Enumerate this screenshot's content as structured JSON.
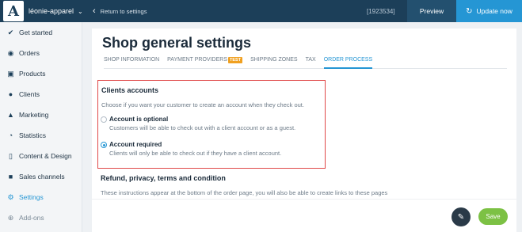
{
  "topbar": {
    "logo_letter": "A",
    "store_name": "léonie-apparel",
    "back_label": "Return to settings",
    "order_id": "[1923534]",
    "preview_label": "Preview",
    "update_label": "Update now"
  },
  "sidebar": {
    "items": [
      {
        "label": "Get started",
        "icon": "check-circle-icon"
      },
      {
        "label": "Orders",
        "icon": "dollar-circle-icon"
      },
      {
        "label": "Products",
        "icon": "cart-icon"
      },
      {
        "label": "Clients",
        "icon": "users-icon"
      },
      {
        "label": "Marketing",
        "icon": "bell-icon"
      },
      {
        "label": "Statistics",
        "icon": "pie-chart-icon"
      },
      {
        "label": "Content & Design",
        "icon": "tablet-icon"
      },
      {
        "label": "Sales channels",
        "icon": "store-icon"
      },
      {
        "label": "Settings",
        "icon": "gear-icon"
      },
      {
        "label": "Add-ons",
        "icon": "plus-circle-icon"
      }
    ]
  },
  "main": {
    "title": "Shop general settings",
    "tabs": [
      {
        "label": "SHOP INFORMATION"
      },
      {
        "label": "PAYMENT PROVIDERS",
        "badge": "TEST"
      },
      {
        "label": "SHIPPING ZONES"
      },
      {
        "label": "TAX"
      },
      {
        "label": "ORDER PROCESS"
      }
    ],
    "clients_accounts": {
      "title": "Clients accounts",
      "description": "Choose if you want your customer to create an account when they check out.",
      "options": [
        {
          "title": "Account is optional",
          "description": "Customers will be able to check out with a client account or as a guest.",
          "checked": false
        },
        {
          "title": "Account required",
          "description": "Clients will only be able to check out if they have a client account.",
          "checked": true
        }
      ]
    },
    "refund": {
      "title": "Refund, privacy, terms and condition",
      "description": "These instructions appear at the bottom of the order page, you will also be able to create links to these pages"
    },
    "save_label": "Save"
  },
  "colors": {
    "topbar": "#1c3f59",
    "accent": "#2596d4",
    "save": "#7cc144",
    "highlight": "#e04848",
    "badge": "#f0a020"
  }
}
